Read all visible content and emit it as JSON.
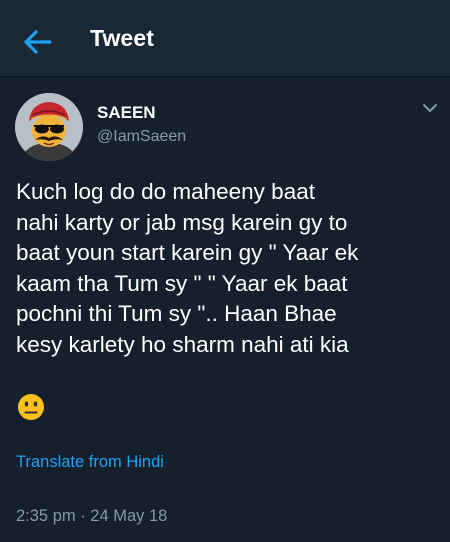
{
  "header": {
    "title": "Tweet",
    "back_icon": "back-arrow-icon"
  },
  "author": {
    "display_name": "SAEEN",
    "handle": "@IamSaeen",
    "menu_icon": "chevron-down-icon"
  },
  "tweet": {
    "text": "Kuch log do do maheeny baat\nnahi karty or jab msg karein gy to\nbaat youn start karein gy \" Yaar ek\nkaam tha Tum sy \" \" Yaar ek baat\npochni thi Tum sy \".. Haan Bhae\nkesy karlety ho sharm nahi ati kia",
    "emoji": "neutral-face-emoji",
    "translate_label": "Translate from Hindi",
    "timestamp": "2:35 pm · 24 May 18"
  },
  "colors": {
    "background": "#15202c",
    "topbar": "#1a2734",
    "accent": "#1da1f2",
    "secondary_text": "#8899a6"
  }
}
